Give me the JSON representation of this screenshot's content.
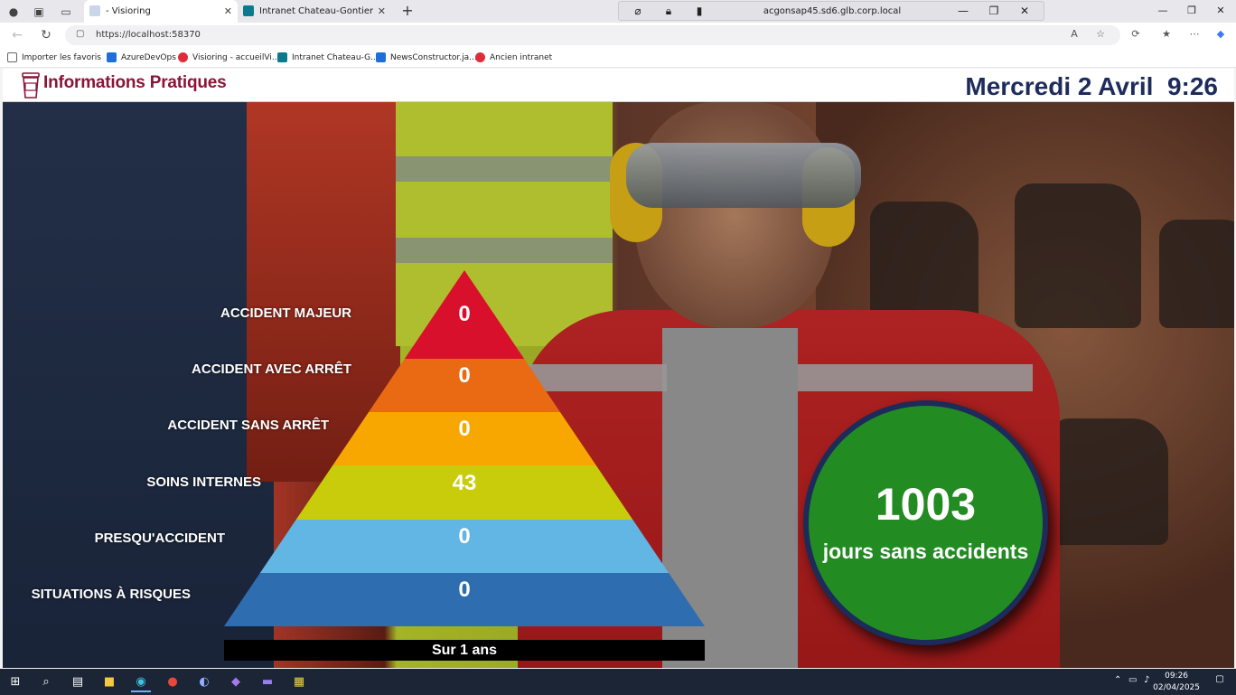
{
  "browser": {
    "tabs": [
      {
        "title": "- Visioring",
        "active": true
      },
      {
        "title": "Intranet Chateau-Gontier - Actual",
        "active": false
      }
    ],
    "remote_host": "acgonsap45.sd6.glb.corp.local",
    "url": "https://localhost:58370",
    "favorites": [
      {
        "label": "Importer les favoris",
        "icon": "import-icon"
      },
      {
        "label": "AzureDevOps",
        "icon": "azure-devops-icon"
      },
      {
        "label": "Visioring - accueilVi...",
        "icon": "visioring-icon"
      },
      {
        "label": "Intranet Chateau-G...",
        "icon": "sharepoint-icon"
      },
      {
        "label": "NewsConstructor.ja...",
        "icon": "azure-devops-icon"
      },
      {
        "label": "Ancien intranet",
        "icon": "visioring-icon"
      }
    ]
  },
  "page": {
    "site_title": "Informations Pratiques",
    "datetime": "Mercredi 2 Avril  9:26",
    "pyramid": [
      {
        "label": "ACCIDENT MAJEUR",
        "value": "0",
        "color": "#d8102b"
      },
      {
        "label": "ACCIDENT AVEC ARRÊT",
        "value": "0",
        "color": "#e96a12"
      },
      {
        "label": "ACCIDENT SANS ARRÊT",
        "value": "0",
        "color": "#f7a700"
      },
      {
        "label": "SOINS INTERNES",
        "value": "43",
        "color": "#c8cc0a"
      },
      {
        "label": "PRESQU'ACCIDENT",
        "value": "0",
        "color": "#62b6e4"
      },
      {
        "label": "SITUATIONS À RISQUES",
        "value": "0",
        "color": "#2f6db1"
      }
    ],
    "period": "Sur 1 ans",
    "days_without_accident": "1003",
    "days_label": "jours sans accidents",
    "circle_color": "#228b22"
  },
  "taskbar": {
    "time": "09:26",
    "date": "02/04/2025"
  }
}
